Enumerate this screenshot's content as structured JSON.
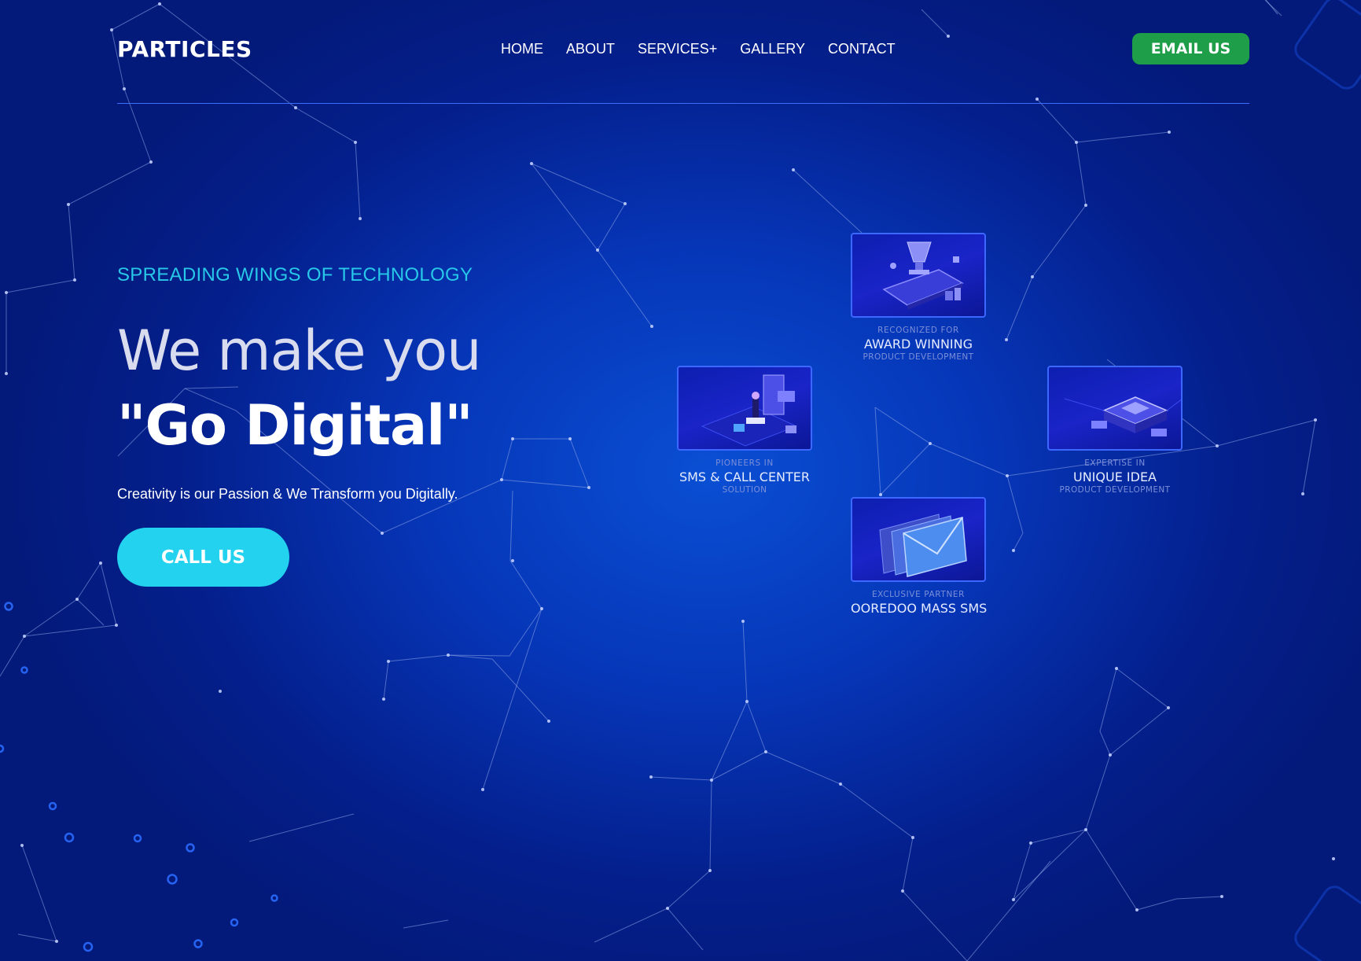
{
  "header": {
    "logo": "PARTICLES",
    "nav": [
      {
        "label": "HOME"
      },
      {
        "label": "ABOUT"
      },
      {
        "label": "SERVICES+"
      },
      {
        "label": "GALLERY"
      },
      {
        "label": "CONTACT"
      }
    ],
    "email_button": "EMAIL US"
  },
  "hero": {
    "tagline": "SPREADING WINGS OF TECHNOLOGY",
    "headline_line1": "We make you",
    "headline_line2": "\"Go Digital\"",
    "subtext": "Creativity is our Passion & We Transform you Digitally.",
    "call_button": "CALL US"
  },
  "features": [
    {
      "kicker": "RECOGNIZED FOR",
      "title": "AWARD WINNING",
      "sub": "PRODUCT DEVELOPMENT",
      "icon": "trophy-phone-icon"
    },
    {
      "kicker": "PIONEERS IN",
      "title": "SMS & CALL CENTER",
      "sub": "SOLUTION",
      "icon": "call-center-icon"
    },
    {
      "kicker": "EXPERTISE IN",
      "title": "UNIQUE IDEA",
      "sub": "PRODUCT DEVELOPMENT",
      "icon": "chip-icon"
    },
    {
      "kicker": "EXCLUSIVE PARTNER",
      "title": "OOREDOO MASS SMS",
      "sub": "",
      "icon": "envelope-icon"
    }
  ],
  "colors": {
    "background": "#0636b8",
    "accent_cyan": "#22d2ee",
    "email_green": "#1f9e49",
    "tagline": "#28c8e8"
  }
}
